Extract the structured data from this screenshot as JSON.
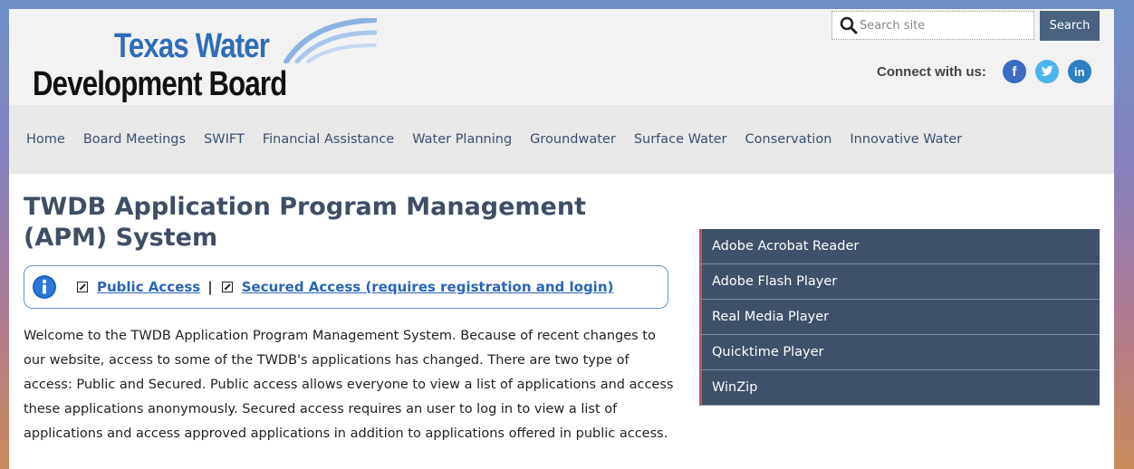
{
  "header": {
    "logo": {
      "line1": "Texas Water",
      "line2": "Development Board"
    },
    "search": {
      "placeholder": "Search site",
      "button_label": "Search"
    },
    "connect": {
      "label": "Connect with us:",
      "icons": [
        "facebook-icon",
        "twitter-icon",
        "linkedin-icon"
      ],
      "facebook": "f",
      "twitter": "t",
      "linkedin": "in"
    }
  },
  "nav": {
    "items": [
      "Home",
      "Board Meetings",
      "SWIFT",
      "Financial Assistance",
      "Water Planning",
      "Groundwater",
      "Surface Water",
      "Conservation",
      "Innovative Water"
    ]
  },
  "main": {
    "title": "TWDB Application Program Management (APM) System",
    "access": {
      "public_link": "Public Access",
      "separator": "|",
      "secured_link": "Secured Access (requires registration and login)"
    },
    "welcome": "Welcome to the TWDB Application Program Management System.  Because of recent changes to our website, access to some of the TWDB's applications has changed.  There are two type of access: Public and Secured.  Public access allows everyone to view a list of applications and access these applications anonymously.  Secured access requires an user to log in to view a list of applications and access approved applications in addition to applications offered in public access."
  },
  "sidebar": {
    "items": [
      "Adobe Acrobat Reader",
      "Adobe Flash Player",
      "Real Media Player",
      "Quicktime Player",
      "WinZip"
    ]
  },
  "colors": {
    "nav_text": "#3a4f6e",
    "sidebar_bg": "#3f5168",
    "link": "#2a64b8",
    "brand_blue": "#2f6db8"
  }
}
